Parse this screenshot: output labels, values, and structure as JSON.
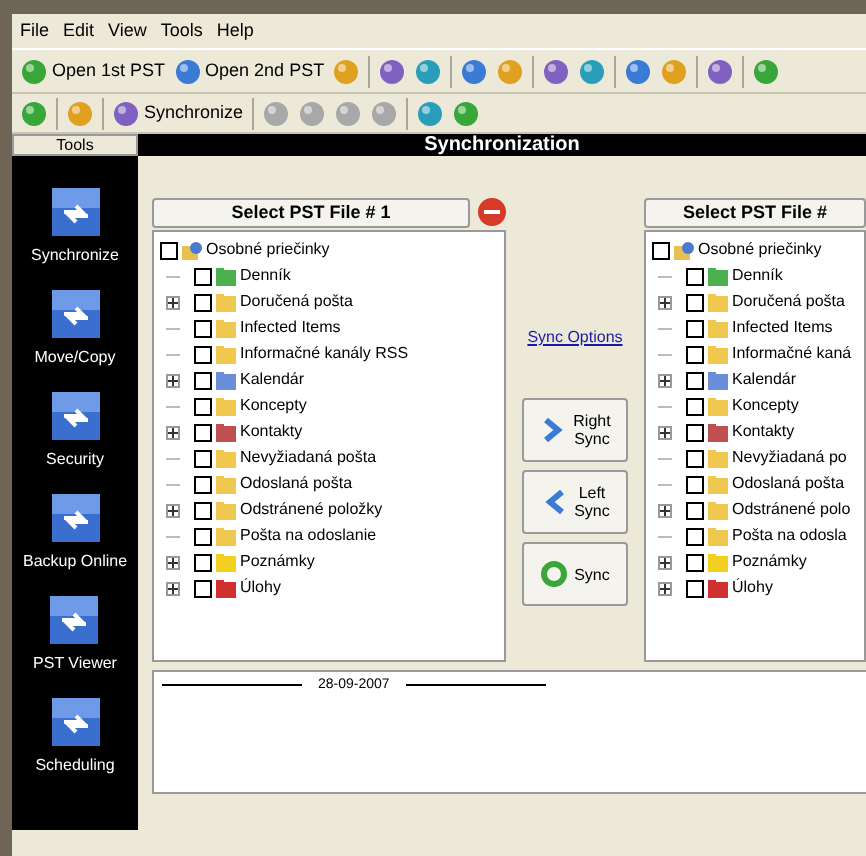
{
  "menu": [
    "File",
    "Edit",
    "View",
    "Tools",
    "Help"
  ],
  "toolbar": [
    {
      "kind": "labeled",
      "label": "Open 1st PST"
    },
    {
      "kind": "labeled",
      "label": "Open 2nd PST"
    },
    {
      "kind": "icon"
    },
    {
      "kind": "separator"
    },
    {
      "kind": "icon"
    },
    {
      "kind": "icon"
    },
    {
      "kind": "separator"
    },
    {
      "kind": "icon"
    },
    {
      "kind": "icon"
    },
    {
      "kind": "separator"
    },
    {
      "kind": "icon"
    },
    {
      "kind": "icon"
    },
    {
      "kind": "separator"
    },
    {
      "kind": "icon"
    },
    {
      "kind": "icon"
    },
    {
      "kind": "separator"
    },
    {
      "kind": "icon"
    },
    {
      "kind": "separator"
    },
    {
      "kind": "icon"
    }
  ],
  "toolbar2": [
    {
      "kind": "icon"
    },
    {
      "kind": "separator"
    },
    {
      "kind": "icon"
    },
    {
      "kind": "separator"
    },
    {
      "kind": "labeled",
      "label": "Synchronize"
    },
    {
      "kind": "separator"
    },
    {
      "kind": "icon",
      "disabled": true
    },
    {
      "kind": "icon",
      "disabled": true
    },
    {
      "kind": "icon",
      "disabled": true
    },
    {
      "kind": "icon",
      "disabled": true
    },
    {
      "kind": "separator"
    },
    {
      "kind": "icon"
    },
    {
      "kind": "icon"
    }
  ],
  "sidebar": {
    "title": "Tools",
    "items": [
      {
        "label": "Synchronize"
      },
      {
        "label": "Move/Copy"
      },
      {
        "label": "Security"
      },
      {
        "label": "Backup Online"
      },
      {
        "label": "PST Viewer"
      },
      {
        "label": "Scheduling"
      }
    ]
  },
  "main_title": "Synchronization",
  "left_panel": {
    "select_button": "Select PST File # 1",
    "root": {
      "label": "Osobné priečinky",
      "checked": false
    },
    "items": [
      {
        "label": "Denník",
        "kind": "journal",
        "expandable": false,
        "checked": false
      },
      {
        "label": "Doručená pošta",
        "kind": "folder",
        "expandable": true,
        "checked": false
      },
      {
        "label": "Infected Items",
        "kind": "folder",
        "expandable": false,
        "checked": false
      },
      {
        "label": "Informačné kanály RSS",
        "kind": "folder",
        "expandable": false,
        "checked": false
      },
      {
        "label": "Kalendár",
        "kind": "calendar",
        "expandable": true,
        "checked": false
      },
      {
        "label": "Koncepty",
        "kind": "folder",
        "expandable": false,
        "checked": false
      },
      {
        "label": "Kontakty",
        "kind": "contacts",
        "expandable": true,
        "checked": false
      },
      {
        "label": "Nevyžiadaná pošta",
        "kind": "folder",
        "expandable": false,
        "checked": false
      },
      {
        "label": "Odoslaná pošta",
        "kind": "folder",
        "expandable": false,
        "checked": false
      },
      {
        "label": "Odstránené položky",
        "kind": "folder",
        "expandable": true,
        "checked": false
      },
      {
        "label": "Pošta na odoslanie",
        "kind": "folder",
        "expandable": false,
        "checked": false
      },
      {
        "label": "Poznámky",
        "kind": "notes",
        "expandable": true,
        "checked": false
      },
      {
        "label": "Úlohy",
        "kind": "tasks",
        "expandable": true,
        "checked": false
      }
    ]
  },
  "sync_options": "Sync Options",
  "sync_buttons": [
    {
      "kind": "right",
      "line1": "Right",
      "line2": "Sync"
    },
    {
      "kind": "left",
      "line1": "Left",
      "line2": "Sync"
    },
    {
      "kind": "sync",
      "line1": "Sync"
    }
  ],
  "right_panel": {
    "select_button": "Select PST File #",
    "root": {
      "label": "Osobné priečinky",
      "checked": false
    },
    "items": [
      {
        "label": "Denník",
        "kind": "journal",
        "expandable": false,
        "checked": false
      },
      {
        "label": "Doručená pošta",
        "kind": "folder",
        "expandable": true,
        "checked": false
      },
      {
        "label": "Infected Items",
        "kind": "folder",
        "expandable": false,
        "checked": false
      },
      {
        "label": "Informačné kaná",
        "kind": "folder",
        "expandable": false,
        "checked": false
      },
      {
        "label": "Kalendár",
        "kind": "calendar",
        "expandable": true,
        "checked": false
      },
      {
        "label": "Koncepty",
        "kind": "folder",
        "expandable": false,
        "checked": false
      },
      {
        "label": "Kontakty",
        "kind": "contacts",
        "expandable": true,
        "checked": false
      },
      {
        "label": "Nevyžiadaná po",
        "kind": "folder",
        "expandable": false,
        "checked": false
      },
      {
        "label": "Odoslaná pošta",
        "kind": "folder",
        "expandable": false,
        "checked": false
      },
      {
        "label": "Odstránené polo",
        "kind": "folder",
        "expandable": true,
        "checked": false
      },
      {
        "label": "Pošta na odosla",
        "kind": "folder",
        "expandable": false,
        "checked": false
      },
      {
        "label": "Poznámky",
        "kind": "notes",
        "expandable": true,
        "checked": false
      },
      {
        "label": "Úlohy",
        "kind": "tasks",
        "expandable": true,
        "checked": false
      }
    ]
  },
  "log": {
    "date": "28-09-2007"
  }
}
